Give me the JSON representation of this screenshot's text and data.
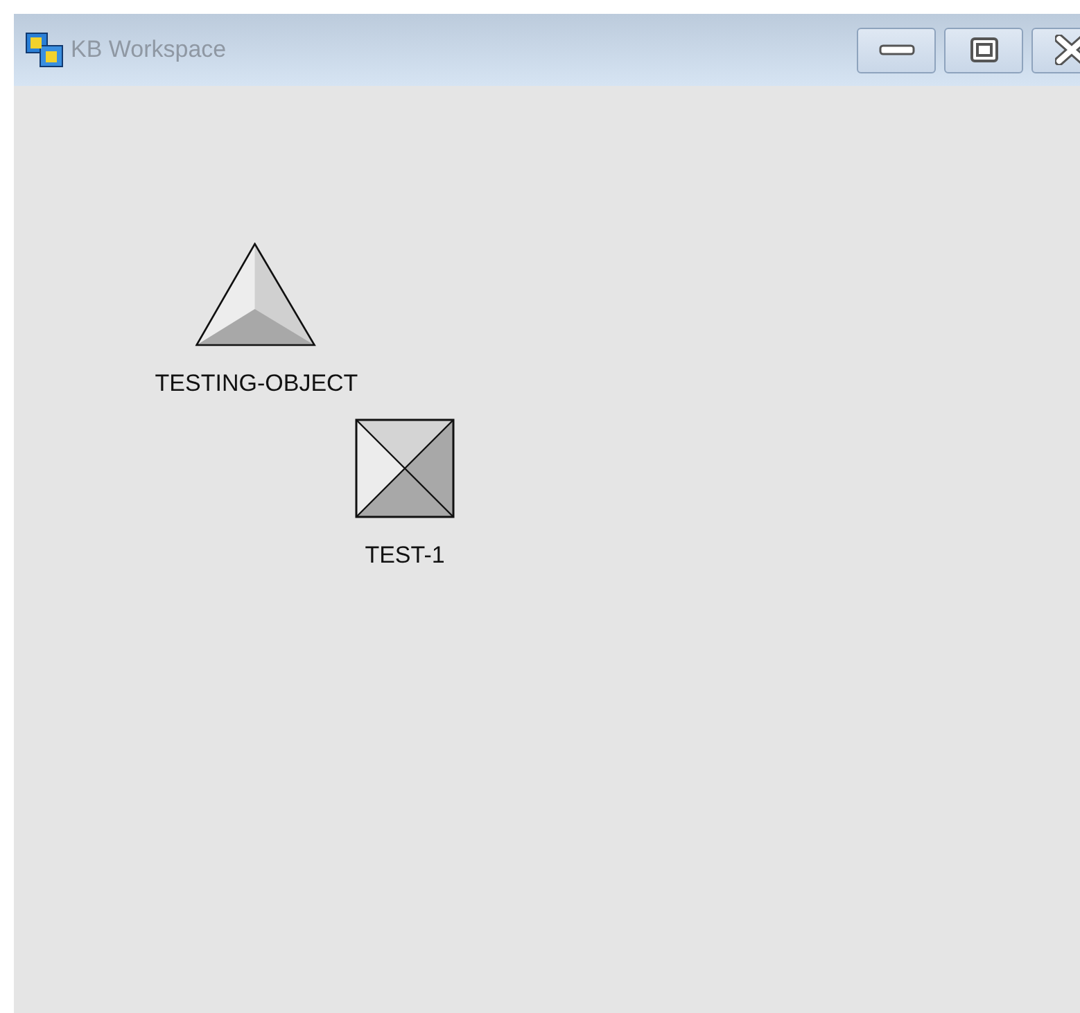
{
  "window": {
    "title": "KB Workspace"
  },
  "objects": [
    {
      "kind": "triangle",
      "label": "TESTING-OBJECT"
    },
    {
      "kind": "box",
      "label": "TEST-1"
    }
  ]
}
